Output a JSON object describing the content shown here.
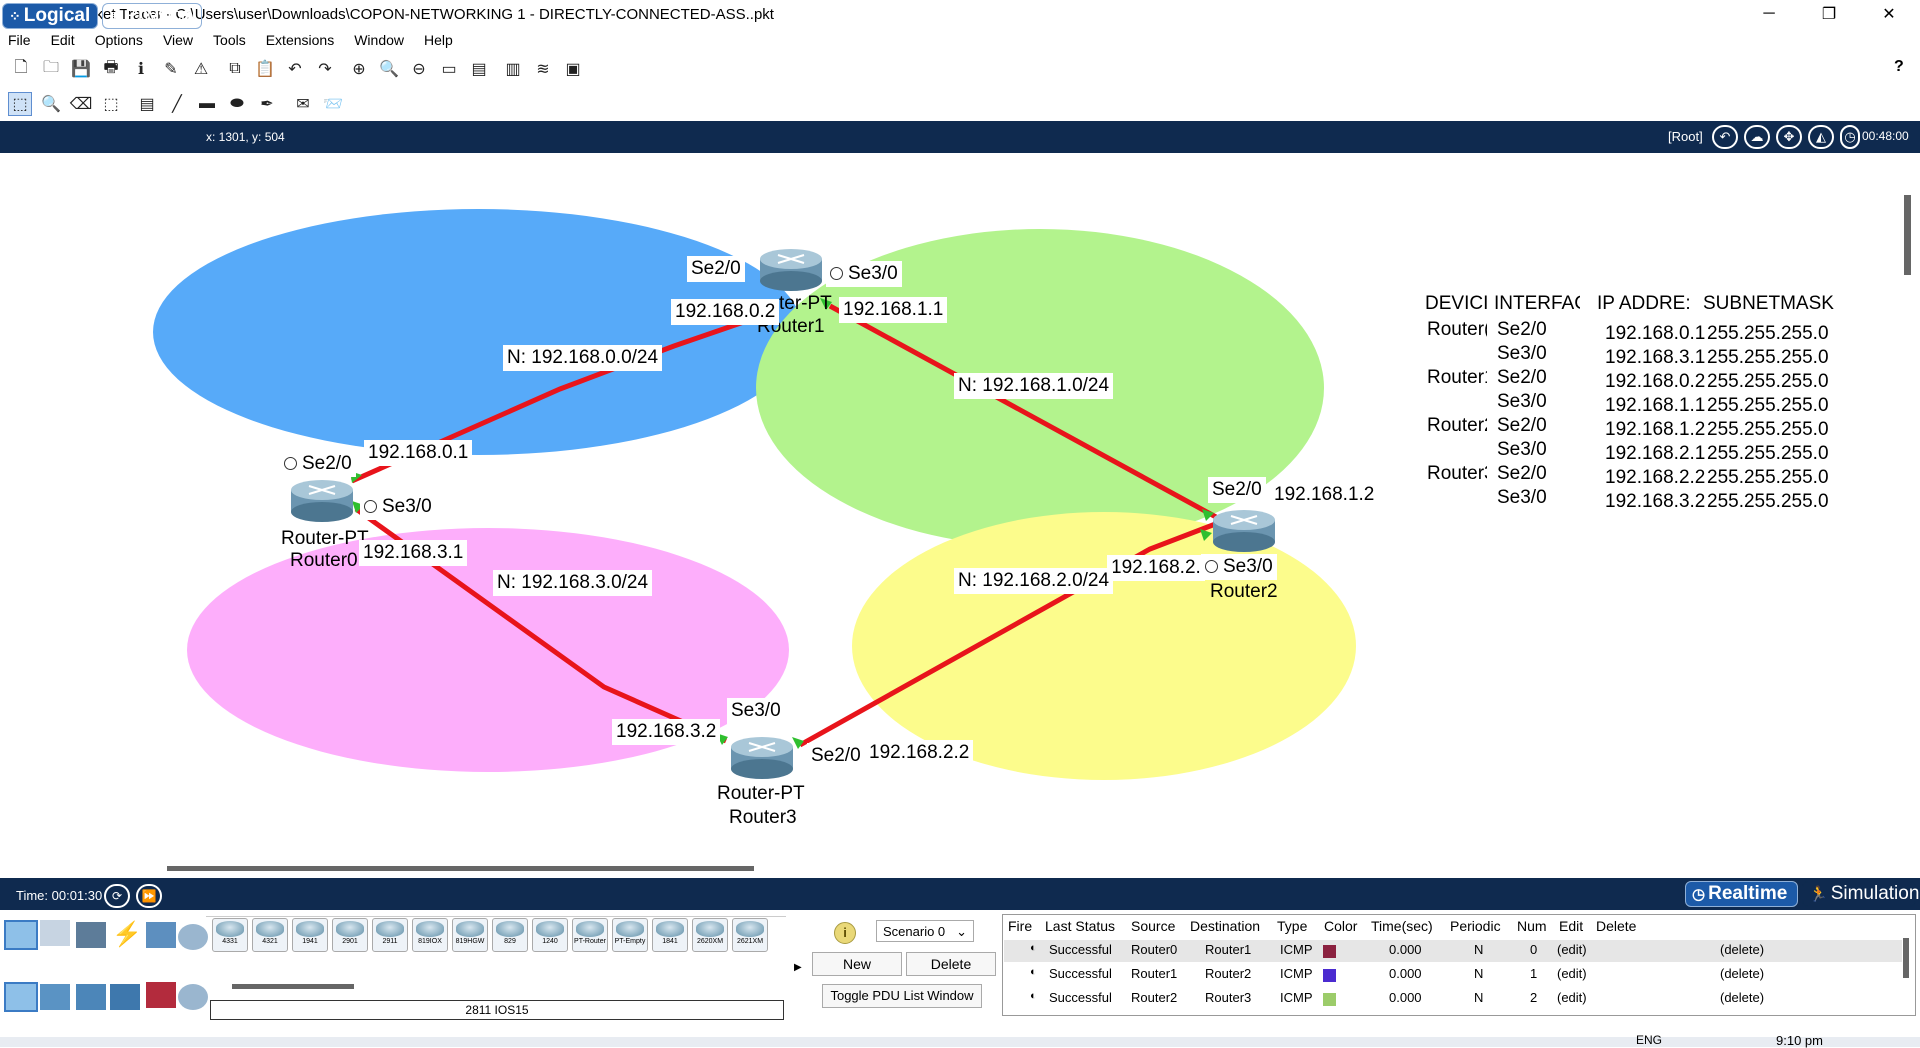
{
  "window": {
    "title": "Cisco Packet Tracer - C:\\Users\\user\\Downloads\\COPON-NETWORKING 1 - DIRECTLY-CONNECTED-ASS..pkt",
    "minimize": "─",
    "restore": "❐",
    "close": "✕"
  },
  "menu": [
    "File",
    "Edit",
    "Options",
    "View",
    "Tools",
    "Extensions",
    "Window",
    "Help"
  ],
  "help_symbol": "?",
  "mode_bar": {
    "logical": "Logical",
    "physical": "Physical",
    "coords": "x: 1301, y: 504",
    "root": "[Root]",
    "clock": "00:48:00"
  },
  "topology": {
    "routers": [
      {
        "type": "Router-PT",
        "name": "Router0"
      },
      {
        "type": "Router-PT",
        "name": "Router1"
      },
      {
        "type": "",
        "name": "Router2"
      },
      {
        "type": "Router-PT",
        "name": "Router3"
      }
    ],
    "network_labels": [
      "N: 192.168.0.0/24",
      "N: 192.168.1.0/24",
      "N: 192.168.2.0/24",
      "N: 192.168.3.0/24"
    ],
    "r0": {
      "se20": "Se2/0",
      "ip1": "192.168.0.1",
      "se30": "Se3/0",
      "ip2": "192.168.3.1",
      "type": "Router-PT",
      "name": "Router0"
    },
    "r1": {
      "se20": "Se2/0",
      "ip1": "192.168.0.2",
      "se30": "Se3/0",
      "ip2": "192.168.1.1",
      "type": "ter-PT",
      "name": "Router1"
    },
    "r2": {
      "se20": "Se2/0",
      "ip1": "192.168.1.2",
      "se30": "Se3/0",
      "ip2": "192.168.2.",
      "name": "Router2"
    },
    "r3": {
      "se30": "Se3/0",
      "ip1": "192.168.3.2",
      "se20": "Se2/0",
      "ip2": "192.168.2.2",
      "type": "Router-PT",
      "name": "Router3"
    },
    "colors": {
      "blue": "#57aaf9",
      "green": "#b3f38d",
      "pink": "#fdaefb",
      "yellow": "#fcfc8c",
      "link": "#e8141b"
    }
  },
  "ip_table": {
    "headers": [
      "DEVICI",
      "INTERFAC",
      "IP ADDRE:",
      "SUBNETMASK"
    ],
    "devices": [
      "Router(",
      "Router1",
      "Router2",
      "Router3"
    ],
    "interfaces": [
      "Se2/0",
      "Se3/0",
      "Se2/0",
      "Se3/0",
      "Se2/0",
      "Se3/0",
      "Se2/0",
      "Se3/0"
    ],
    "ips": [
      "192.168.0.1",
      "192.168.3.1",
      "192.168.0.2",
      "192.168.1.1",
      "192.168.1.2",
      "192.168.2.1",
      "192.168.2.2",
      "192.168.3.2"
    ],
    "masks": [
      "255.255.255.0",
      "255.255.255.0",
      "255.255.255.0",
      "255.255.255.0",
      "255.255.255.0",
      "255.255.255.0",
      "255.255.255.0",
      "255.255.255.0"
    ]
  },
  "time_bar": {
    "time": "Time: 00:01:30",
    "realtime": "Realtime",
    "simulation": "Simulation"
  },
  "device_models": [
    "4331",
    "4321",
    "1941",
    "2901",
    "2911",
    "819IOX",
    "819HGW",
    "829",
    "1240",
    "PT-Router",
    "PT-Empty",
    "1841",
    "2620XM",
    "2621XM"
  ],
  "selected_model": "2811 IOS15",
  "scenario": {
    "info_icon": "i",
    "name": "Scenario 0",
    "new": "New",
    "delete": "Delete",
    "toggle": "Toggle PDU List Window"
  },
  "pdu": {
    "headers": [
      "Fire",
      "Last Status",
      "Source",
      "Destination",
      "Type",
      "Color",
      "Time(sec)",
      "Periodic",
      "Num",
      "Edit",
      "Delete"
    ],
    "rows": [
      {
        "status": "Successful",
        "source": "Router0",
        "dest": "Router1",
        "type": "ICMP",
        "color": "#8b2240",
        "time": "0.000",
        "periodic": "N",
        "num": "0",
        "edit": "(edit)",
        "delete": "(delete)"
      },
      {
        "status": "Successful",
        "source": "Router1",
        "dest": "Router2",
        "type": "ICMP",
        "color": "#4b2bd0",
        "time": "0.000",
        "periodic": "N",
        "num": "1",
        "edit": "(edit)",
        "delete": "(delete)"
      },
      {
        "status": "Successful",
        "source": "Router2",
        "dest": "Router3",
        "type": "ICMP",
        "color": "#9ccc6a",
        "time": "0.000",
        "periodic": "N",
        "num": "2",
        "edit": "(edit)",
        "delete": "(delete)"
      }
    ]
  },
  "taskbar": {
    "time": "9:10 pm",
    "lang": "ENG"
  }
}
